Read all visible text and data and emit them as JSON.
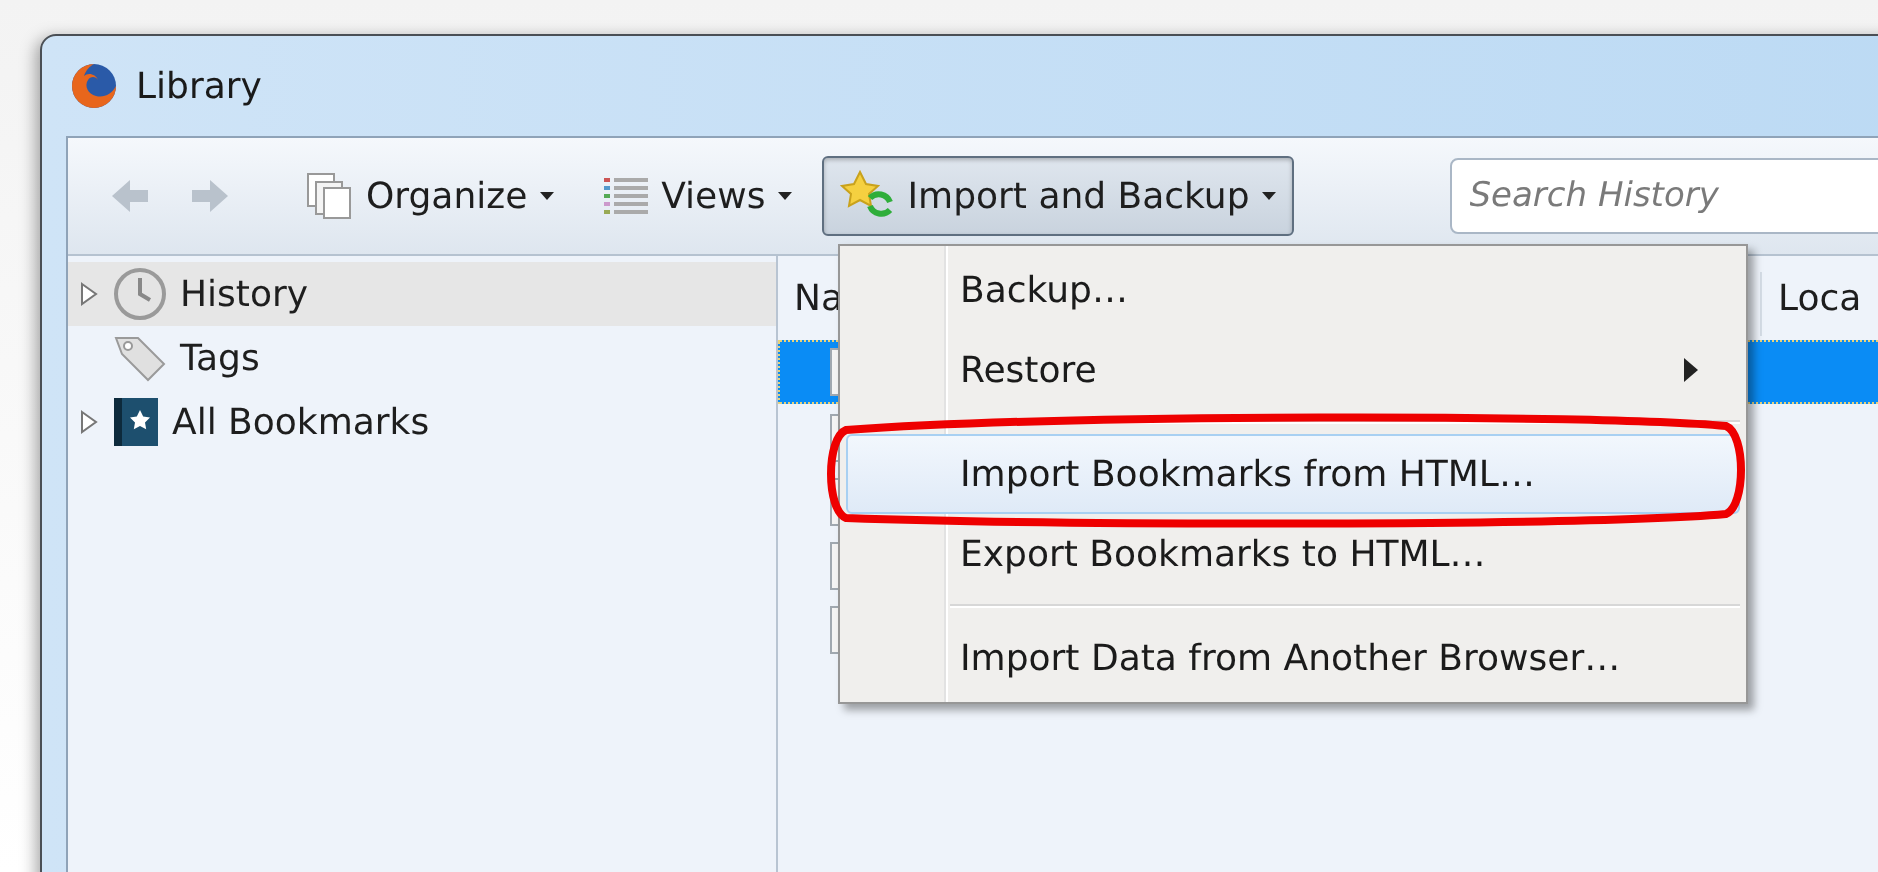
{
  "window": {
    "title": "Library"
  },
  "toolbar": {
    "buttons": [
      {
        "kind": "back",
        "disabled": true
      },
      {
        "kind": "forward",
        "disabled": true
      },
      {
        "kind": "organize",
        "label": "Organize",
        "pressed": false
      },
      {
        "kind": "views",
        "label": "Views",
        "pressed": false
      },
      {
        "kind": "import",
        "label": "Import and Backup",
        "pressed": true
      }
    ],
    "search": {
      "placeholder": "Search History"
    }
  },
  "sidebar": {
    "items": [
      {
        "kind": "history",
        "label": "History",
        "expandable": true,
        "selected": true
      },
      {
        "kind": "tags",
        "label": "Tags",
        "expandable": false,
        "selected": false
      },
      {
        "kind": "bookmarks",
        "label": "All Bookmarks",
        "expandable": true,
        "selected": false
      }
    ]
  },
  "table": {
    "columns": [
      "Na",
      "Loca"
    ],
    "rows": [
      {
        "selected": true
      },
      {
        "selected": false
      },
      {
        "selected": false
      },
      {
        "selected": false
      },
      {
        "selected": false
      }
    ]
  },
  "menu": {
    "items": [
      {
        "kind": "item",
        "label": "Backup…",
        "submenu": false,
        "highlighted": false,
        "circled": false
      },
      {
        "kind": "item",
        "label": "Restore",
        "submenu": true,
        "highlighted": false,
        "circled": false
      },
      {
        "kind": "separator"
      },
      {
        "kind": "item",
        "label": "Import Bookmarks from HTML…",
        "submenu": false,
        "highlighted": true,
        "circled": true
      },
      {
        "kind": "item",
        "label": "Export Bookmarks to HTML…",
        "submenu": false,
        "highlighted": false,
        "circled": false
      },
      {
        "kind": "separator"
      },
      {
        "kind": "item",
        "label": "Import Data from Another Browser…",
        "submenu": false,
        "highlighted": false,
        "circled": false
      }
    ]
  }
}
